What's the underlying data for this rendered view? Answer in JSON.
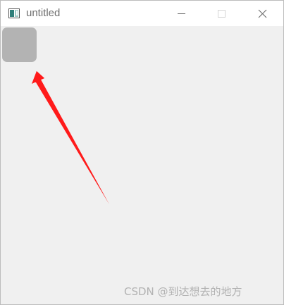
{
  "window": {
    "title": "untitled",
    "icon": "app-window-icon",
    "controls": {
      "minimize_icon": "minimize-icon",
      "maximize_icon": "maximize-icon",
      "close_icon": "close-icon"
    }
  },
  "client": {
    "widget": "square-widget",
    "annotation": {
      "type": "arrow",
      "color": "#ff1a1a"
    }
  },
  "watermark": "CSDN @到达想去的地方"
}
